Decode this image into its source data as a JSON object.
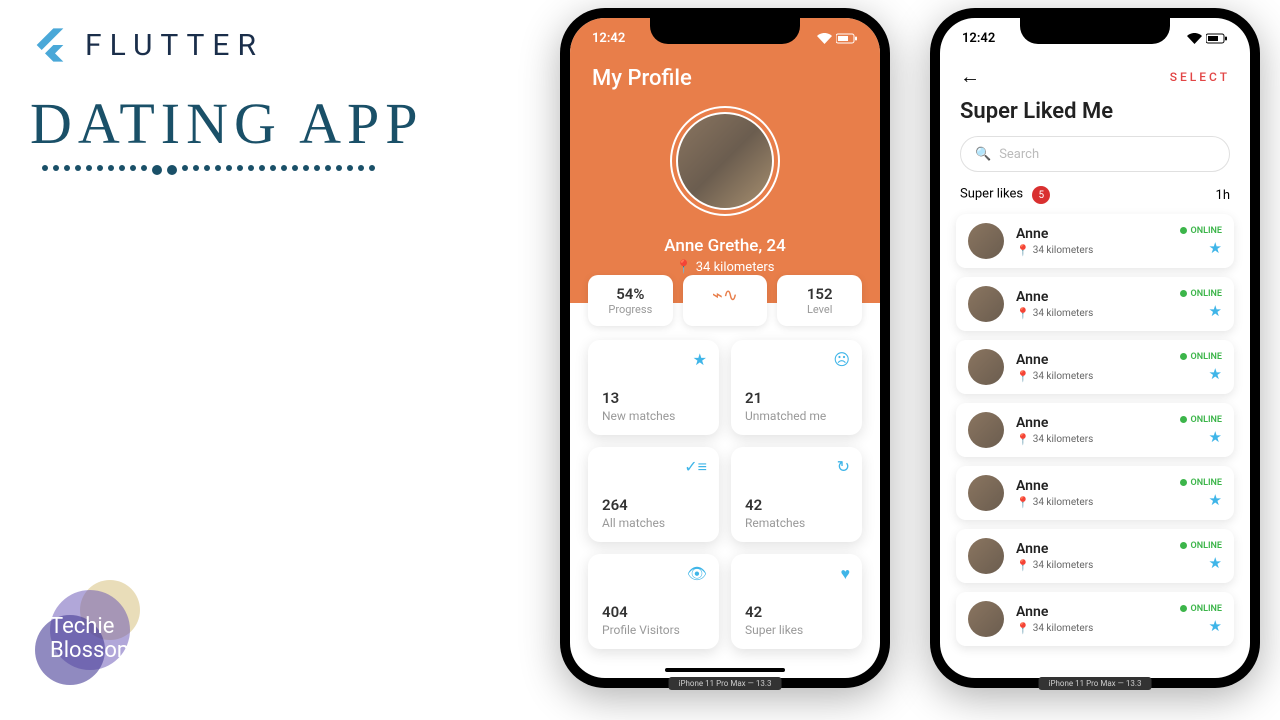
{
  "header": {
    "flutter": "FLUTTER"
  },
  "title": "DATING APP",
  "brand": {
    "line1": "Techie",
    "line2": "Blossom"
  },
  "devLabel": "iPhone 11 Pro Max — 13.3",
  "statusTime": "12:42",
  "profile": {
    "title": "My Profile",
    "name": "Anne Grethe, 24",
    "distance": "34 kilometers",
    "stats": {
      "progress": {
        "value": "54%",
        "label": "Progress"
      },
      "level": {
        "value": "152",
        "label": "Level"
      }
    },
    "tiles": [
      {
        "num": "13",
        "label": "New matches",
        "icon": "★"
      },
      {
        "num": "21",
        "label": "Unmatched me",
        "icon": "☹"
      },
      {
        "num": "264",
        "label": "All matches",
        "icon": "✓≡"
      },
      {
        "num": "42",
        "label": "Rematches",
        "icon": "↻"
      },
      {
        "num": "404",
        "label": "Profile Visitors",
        "icon": "👁"
      },
      {
        "num": "42",
        "label": "Super likes",
        "icon": "♥"
      }
    ]
  },
  "superLiked": {
    "select": "SELECT",
    "title": "Super Liked Me",
    "searchPlaceholder": "Search",
    "metaLabel": "Super likes",
    "metaCount": "5",
    "metaTime": "1h",
    "onlineLabel": "ONLINE",
    "items": [
      {
        "name": "Anne",
        "distance": "34 kilometers"
      },
      {
        "name": "Anne",
        "distance": "34 kilometers"
      },
      {
        "name": "Anne",
        "distance": "34 kilometers"
      },
      {
        "name": "Anne",
        "distance": "34 kilometers"
      },
      {
        "name": "Anne",
        "distance": "34 kilometers"
      },
      {
        "name": "Anne",
        "distance": "34 kilometers"
      },
      {
        "name": "Anne",
        "distance": "34 kilometers"
      }
    ]
  }
}
